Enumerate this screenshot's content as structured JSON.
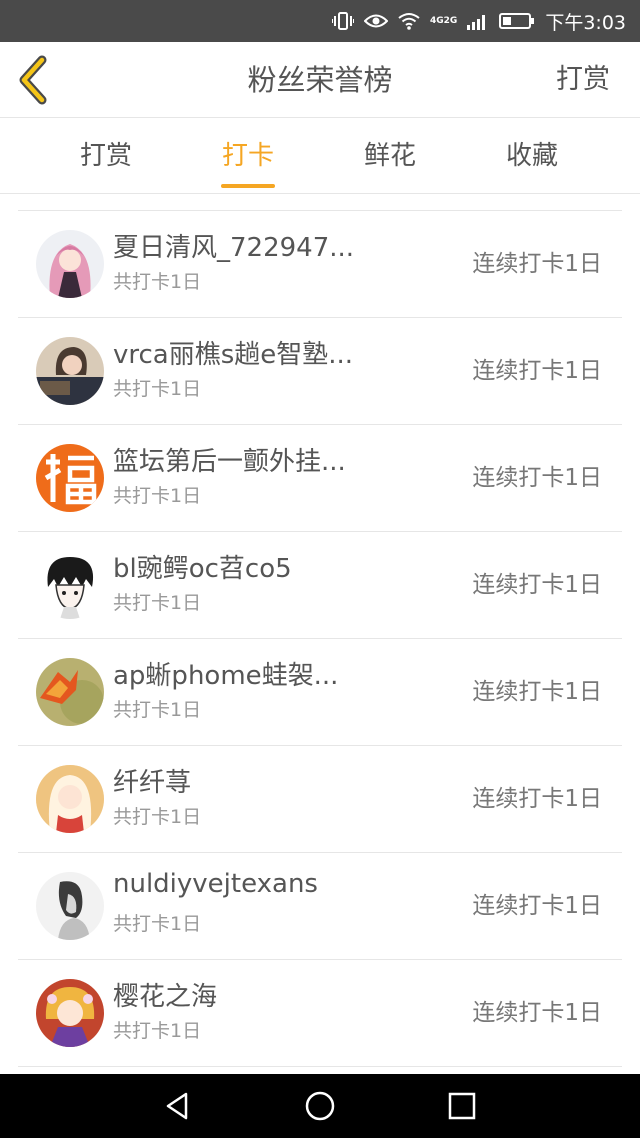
{
  "status_bar": {
    "network_top": "4G",
    "network_bottom": "2G",
    "time": "下午3:03",
    "icons": [
      "vibrate-icon",
      "eye-comfort-icon",
      "wifi-icon",
      "signal-icon",
      "battery-icon"
    ]
  },
  "header": {
    "back_icon": "chevron-left-icon",
    "title": "粉丝荣誉榜",
    "action_label": "打赏"
  },
  "tabs": [
    {
      "label": "打赏",
      "active": false
    },
    {
      "label": "打卡",
      "active": true
    },
    {
      "label": "鲜花",
      "active": false
    },
    {
      "label": "收藏",
      "active": false
    }
  ],
  "list": {
    "items": [
      {
        "name": "夏日清风_722947...",
        "total": "共打卡1日",
        "streak": "连续打卡1日"
      },
      {
        "name": "vrca丽樵s趟e智塾...",
        "total": "共打卡1日",
        "streak": "连续打卡1日"
      },
      {
        "name": "篮坛第后一颤外挂...",
        "total": "共打卡1日",
        "streak": "连续打卡1日"
      },
      {
        "name": "bl豌鳄oc苕co5",
        "total": "共打卡1日",
        "streak": "连续打卡1日"
      },
      {
        "name": "ap蜥phome蛙袈...",
        "total": "共打卡1日",
        "streak": "连续打卡1日"
      },
      {
        "name": "纤纤荨",
        "total": "共打卡1日",
        "streak": "连续打卡1日"
      },
      {
        "name": "nuldiyvejtexans",
        "total": "共打卡1日",
        "streak": "连续打卡1日"
      },
      {
        "name": "樱花之海",
        "total": "共打卡1日",
        "streak": "连续打卡1日"
      }
    ]
  },
  "system_nav": {
    "buttons": [
      "back-triangle-icon",
      "home-circle-icon",
      "recents-square-icon"
    ]
  },
  "colors": {
    "accent": "#f5a623",
    "text_primary": "#555555",
    "text_secondary": "#999999",
    "status_bar_bg": "#4a4a4a",
    "divider": "#e6e6e6"
  }
}
